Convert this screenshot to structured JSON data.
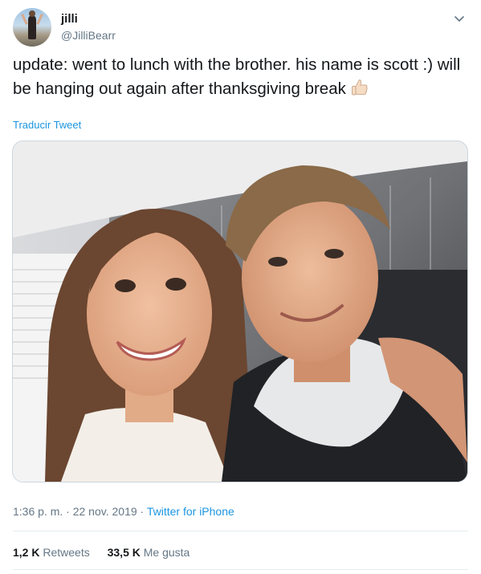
{
  "author": {
    "display_name": "jilli",
    "handle": "@JilliBearr"
  },
  "tweet": {
    "text": "update: went to lunch with the brother. his name is scott :) will be hanging out again after thanksgiving break",
    "emoji_icon": "thumbs-up-emoji"
  },
  "translate_label": "Traducir Tweet",
  "meta": {
    "time": "1:36 p. m.",
    "separator": " · ",
    "date": "22 nov. 2019",
    "source": "Twitter for iPhone"
  },
  "stats": {
    "retweets_count": "1,2 K",
    "retweets_label": "Retweets",
    "likes_count": "33,5 K",
    "likes_label": "Me gusta"
  },
  "colors": {
    "link": "#1b95e0",
    "secondary_text": "#657786",
    "primary_text": "#14171a",
    "divider": "#e6ecf0"
  },
  "icons": [
    "avatar",
    "chevron-down-icon",
    "thumbs-up-emoji",
    "tweet-photo"
  ]
}
